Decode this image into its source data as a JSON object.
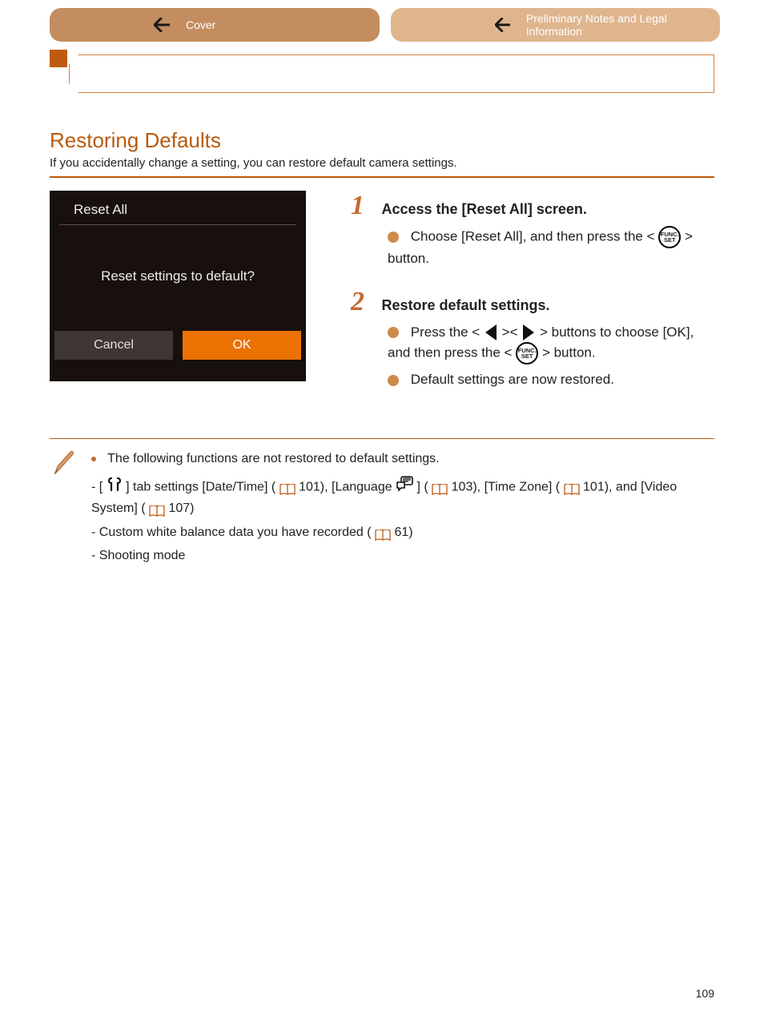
{
  "nav": {
    "left": "Cover",
    "right": "Preliminary Notes and Legal Information"
  },
  "section": {
    "title": "Restoring Defaults",
    "sub": "If you accidentally change a setting, you can restore default camera settings."
  },
  "camera": {
    "title": "Reset All",
    "message": "Reset settings to default?",
    "cancel": "Cancel",
    "ok": "OK"
  },
  "steps": {
    "s1_title": "Access the [Reset All] screen.",
    "s1_body_a": "Choose [Reset All], and then press the <",
    "s1_body_b": "> button.",
    "s2_title": "Restore default settings.",
    "s2_body_a": "Press the <",
    "s2_body_b": "><",
    "s2_body_c": "> buttons to choose [OK], and then press the <",
    "s2_body_d": "> button.",
    "s2_body_e": "Default settings are now restored."
  },
  "note": {
    "intro": "The following functions are not restored to default settings.",
    "line1a": "[",
    "line1b": "] tab settings [Date/Time] (",
    "line1c": "101), [Language",
    "line1d": "] (",
    "line1e": "103), [Time Zone] (",
    "line1f": "101), and [Video System] (",
    "line1g": "107)",
    "line2a": "Custom white balance data you have recorded (",
    "line2b": "61)",
    "line3": "Shooting mode"
  },
  "pagenum": "109"
}
